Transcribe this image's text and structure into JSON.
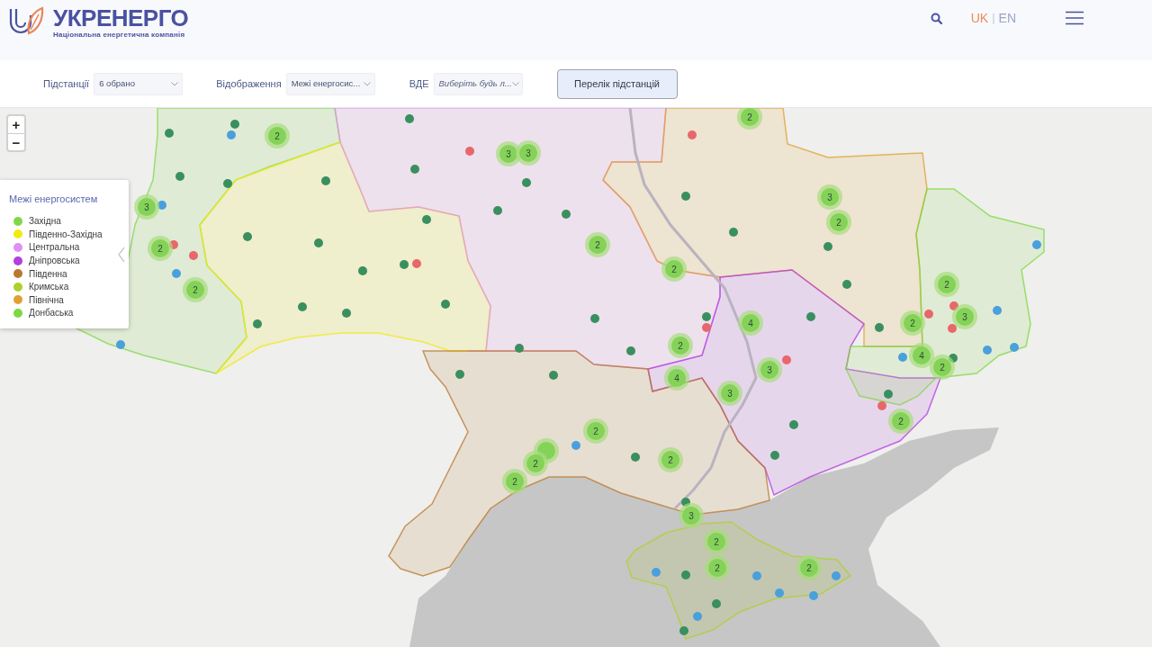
{
  "header": {
    "logo_title": "УКРЕНЕРГО",
    "logo_subtitle": "Національна енергетична компанія",
    "languages": [
      {
        "label": "UK",
        "selected": true
      },
      {
        "label": "EN",
        "selected": false
      }
    ],
    "language_separator": "|"
  },
  "filters": [
    {
      "label": "Підстанції",
      "value": "6 обрано"
    },
    {
      "label": "Відображення",
      "value": "Межі енергосис..."
    },
    {
      "label": "ВДЕ",
      "placeholder": "Виберіть будь л..."
    }
  ],
  "list_button": "Перелік підстанцій",
  "map": {
    "zoom_controls": [
      "+",
      "−"
    ],
    "legend": {
      "title": "Межі енергосистем",
      "items": [
        {
          "label": "Західна",
          "color": "#80d848"
        },
        {
          "label": "Південно-Західна",
          "color": "#f2ea10"
        },
        {
          "label": "Центральна",
          "color": "#e090f2"
        },
        {
          "label": "Дніпровська",
          "color": "#b43ee0"
        },
        {
          "label": "Південна",
          "color": "#b87a30"
        },
        {
          "label": "Кримська",
          "color": "#aed02c"
        },
        {
          "label": "Північна",
          "color": "#e0a030"
        },
        {
          "label": "Донбаська",
          "color": "#7ed840"
        }
      ]
    },
    "stations": [
      {
        "color": "#3a8f5f"
      },
      {
        "color": "#3a8f5f"
      },
      {
        "color": "#3a8f5f"
      },
      {
        "color": "#3a8f5f"
      },
      {
        "color": "#3a8f5f"
      },
      {
        "color": "#3a8f5f"
      },
      {
        "color": "#3a8f5f"
      },
      {
        "color": "#3a8f5f"
      },
      {
        "color": "#3a8f5f"
      },
      {
        "color": "#3a8f5f"
      },
      {
        "color": "#3a8f5f"
      },
      {
        "color": "#3a8f5f"
      },
      {
        "color": "#3a8f5f"
      },
      {
        "color": "#3a8f5f"
      },
      {
        "color": "#3a8f5f"
      },
      {
        "color": "#3a8f5f"
      },
      {
        "color": "#3a8f5f"
      },
      {
        "color": "#3a8f5f"
      },
      {
        "color": "#3a8f5f"
      },
      {
        "color": "#3a8f5f"
      },
      {
        "color": "#3a8f5f"
      },
      {
        "color": "#3a8f5f"
      },
      {
        "color": "#3a8f5f"
      },
      {
        "color": "#3a8f5f"
      },
      {
        "color": "#3a8f5f"
      },
      {
        "color": "#3a8f5f"
      },
      {
        "color": "#3a8f5f"
      },
      {
        "color": "#3a8f5f"
      },
      {
        "color": "#3a8f5f"
      },
      {
        "color": "#3a8f5f"
      },
      {
        "color": "#3a8f5f"
      },
      {
        "color": "#3a8f5f"
      },
      {
        "color": "#3a8f5f"
      },
      {
        "color": "#3a8f5f"
      },
      {
        "color": "#3a8f5f"
      },
      {
        "color": "#3a8f5f"
      },
      {
        "color": "#3a8f5f"
      },
      {
        "color": "#3a8f5f"
      },
      {
        "color": "#3a8f5f"
      },
      {
        "color": "#3a8f5f"
      },
      {
        "color": "#e8676a"
      },
      {
        "color": "#e8676a"
      },
      {
        "color": "#e8676a"
      },
      {
        "color": "#e8676a"
      },
      {
        "color": "#e8676a"
      },
      {
        "color": "#e8676a"
      },
      {
        "color": "#e8676a"
      },
      {
        "color": "#e8676a"
      },
      {
        "color": "#e8676a"
      },
      {
        "color": "#e8676a"
      },
      {
        "color": "#e8676a"
      },
      {
        "color": "#4aa0dc"
      },
      {
        "color": "#4aa0dc"
      },
      {
        "color": "#4aa0dc"
      },
      {
        "color": "#4aa0dc"
      },
      {
        "color": "#4aa0dc"
      },
      {
        "color": "#4aa0dc"
      },
      {
        "color": "#4aa0dc"
      },
      {
        "color": "#4aa0dc"
      },
      {
        "color": "#4aa0dc"
      },
      {
        "color": "#4aa0dc"
      },
      {
        "color": "#4aa0dc"
      },
      {
        "color": "#4aa0dc"
      },
      {
        "color": "#4aa0dc"
      },
      {
        "color": "#4aa0dc"
      },
      {
        "color": "#4aa0dc"
      },
      {
        "color": "#4aa0dc"
      }
    ],
    "clusters": [
      {
        "kind": "cluster",
        "count": "2"
      },
      {
        "kind": "cluster",
        "count": "3"
      },
      {
        "kind": "cluster",
        "count": "2"
      },
      {
        "kind": "cluster",
        "count": "2"
      },
      {
        "kind": "cluster",
        "count": "3"
      },
      {
        "kind": "cluster",
        "count": "3"
      },
      {
        "kind": "cluster",
        "count": "2"
      },
      {
        "kind": "cluster",
        "count": "2"
      },
      {
        "kind": "cluster",
        "count": "2"
      },
      {
        "kind": "cluster",
        "count": "3"
      },
      {
        "kind": "cluster",
        "count": "2"
      },
      {
        "kind": "cluster",
        "count": "2"
      },
      {
        "kind": "cluster",
        "count": "2"
      },
      {
        "kind": "cluster",
        "count": "3"
      },
      {
        "kind": "cluster",
        "count": "4"
      },
      {
        "kind": "cluster",
        "count": "2"
      },
      {
        "kind": "cluster",
        "count": "4"
      },
      {
        "kind": "cluster",
        "count": "3"
      },
      {
        "kind": "cluster",
        "count": "3"
      },
      {
        "kind": "cluster",
        "count": "4"
      },
      {
        "kind": "cluster",
        "count": "2"
      },
      {
        "kind": "cluster",
        "count": "2"
      },
      {
        "kind": "cluster",
        "count": "2"
      },
      {
        "kind": "covered"
      },
      {
        "kind": "cluster",
        "count": "2"
      },
      {
        "kind": "cluster",
        "count": "2"
      },
      {
        "kind": "cluster",
        "count": "2"
      },
      {
        "kind": "cluster",
        "count": "3"
      },
      {
        "kind": "cluster",
        "count": "2"
      },
      {
        "kind": "cluster",
        "count": "2"
      },
      {
        "kind": "cluster",
        "count": "2"
      }
    ]
  }
}
